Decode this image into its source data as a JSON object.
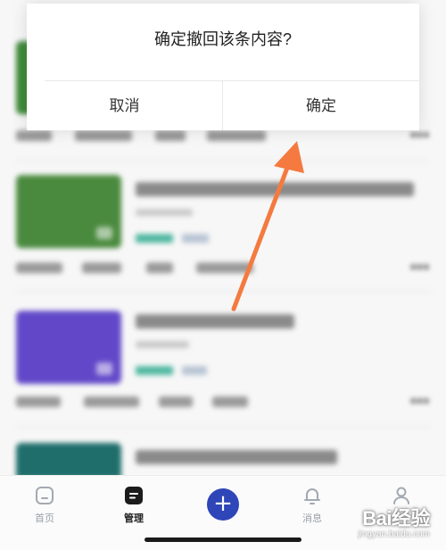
{
  "dialog": {
    "title": "确定撤回该条内容?",
    "cancel_label": "取消",
    "confirm_label": "确定"
  },
  "bottom_nav": {
    "items": [
      {
        "label": "首页",
        "icon": "home-icon",
        "active": false
      },
      {
        "label": "管理",
        "icon": "manage-icon",
        "active": true
      },
      {
        "label": "",
        "icon": "plus-icon",
        "active": false
      },
      {
        "label": "消息",
        "icon": "bell-icon",
        "active": false
      },
      {
        "label": "",
        "icon": "user-icon",
        "active": false
      }
    ]
  },
  "watermark": {
    "brand": "Bai经验",
    "url": "jingyan.baidu.com"
  },
  "colors": {
    "accent": "#2f46b8",
    "annotation_arrow": "#f47a40",
    "active_tag": "#4fb7a0",
    "inactive_tag": "#b8c4d4"
  }
}
